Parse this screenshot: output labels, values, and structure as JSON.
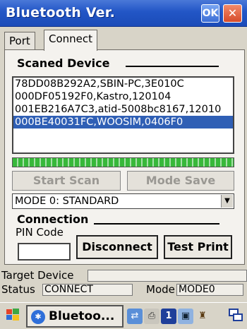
{
  "window": {
    "title": "Bluetooth Ver.",
    "ok_label": "OK",
    "close_label": "✕"
  },
  "tabs": [
    {
      "label": "Port",
      "active": false
    },
    {
      "label": "Connect",
      "active": true
    }
  ],
  "scan_section": {
    "label": "Scaned Device",
    "devices": [
      {
        "text": "78DD08B292A2,SBIN-PC,3E010C",
        "selected": false
      },
      {
        "text": "000DF05192F0,Kastro,120104",
        "selected": false
      },
      {
        "text": "001EB216A7C3,atid-5008bc8167,12010",
        "selected": false
      },
      {
        "text": "000BE40031FC,WOOSIM,0406F0",
        "selected": true
      }
    ],
    "start_scan_label": "Start Scan",
    "mode_save_label": "Mode Save"
  },
  "mode_select": {
    "value": "MODE 0: STANDARD"
  },
  "connection_section": {
    "label": "Connection",
    "pin_label": "PIN Code",
    "pin_value": "",
    "disconnect_label": "Disconnect",
    "test_print_label": "Test Print"
  },
  "status": {
    "target_label": "Target Device",
    "target_value": "",
    "status_label": "Status",
    "status_value": "CONNECT",
    "mode_label": "Mode",
    "mode_value": "MODE0"
  },
  "taskbar": {
    "task_label": "Bluetoo...",
    "icons": [
      "windows-flag-icon",
      "bluetooth-icon",
      "network-icon",
      "printer-icon",
      "input-icon",
      "computer-icon",
      "wizard-icon",
      "desktop-icon"
    ]
  },
  "colors": {
    "titlebar": "#2256c6",
    "selection": "#2f5fb5",
    "progress": "#38b83a"
  }
}
